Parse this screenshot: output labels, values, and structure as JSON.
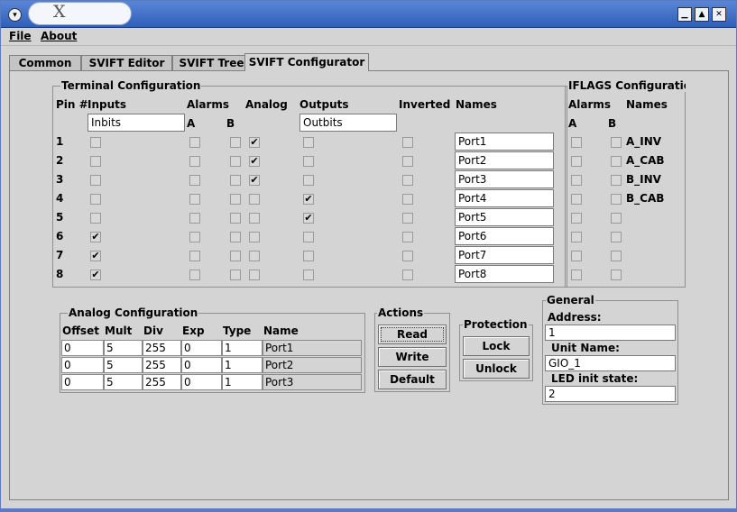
{
  "window": {
    "title_glyph": "X"
  },
  "menu": [
    "File",
    "About"
  ],
  "tabs": [
    "Common",
    "SVIFT Editor",
    "SVIFT Tree",
    "SVIFT Configurator"
  ],
  "terminal": {
    "title": "Terminal Configuration",
    "headers": {
      "pin": "Pin #",
      "inputs": "Inputs",
      "alarms": "Alarms",
      "analog": "Analog",
      "outputs": "Outputs",
      "inverted": "Inverted",
      "names": "Names",
      "a": "A",
      "b": "B"
    },
    "inputs_field": "Inbits",
    "outputs_field": "Outbits",
    "rows": [
      {
        "pin": "1",
        "name": "Port1",
        "input": false,
        "analog": true,
        "output": false
      },
      {
        "pin": "2",
        "name": "Port2",
        "input": false,
        "analog": true,
        "output": false
      },
      {
        "pin": "3",
        "name": "Port3",
        "input": false,
        "analog": true,
        "output": false
      },
      {
        "pin": "4",
        "name": "Port4",
        "input": false,
        "analog": false,
        "output": true
      },
      {
        "pin": "5",
        "name": "Port5",
        "input": false,
        "analog": false,
        "output": true
      },
      {
        "pin": "6",
        "name": "Port6",
        "input": true,
        "analog": false,
        "output": false
      },
      {
        "pin": "7",
        "name": "Port7",
        "input": true,
        "analog": false,
        "output": false
      },
      {
        "pin": "8",
        "name": "Port8",
        "input": true,
        "analog": false,
        "output": false
      }
    ]
  },
  "iflags": {
    "title": "IFLAGS Configuration",
    "headers": {
      "alarms": "Alarms",
      "names": "Names",
      "a": "A",
      "b": "B"
    },
    "names": [
      "A_INV",
      "A_CAB",
      "B_INV",
      "B_CAB",
      "",
      "",
      "",
      ""
    ]
  },
  "analog": {
    "title": "Analog Configuration",
    "headers": [
      "Offset",
      "Mult",
      "Div",
      "Exp",
      "Type",
      "Name"
    ],
    "rows": [
      [
        "0",
        "5",
        "255",
        "0",
        "1",
        "Port1"
      ],
      [
        "0",
        "5",
        "255",
        "0",
        "1",
        "Port2"
      ],
      [
        "0",
        "5",
        "255",
        "0",
        "1",
        "Port3"
      ]
    ]
  },
  "actions": {
    "title": "Actions",
    "read": "Read",
    "write": "Write",
    "default": "Default"
  },
  "protection": {
    "title": "Protection",
    "lock": "Lock",
    "unlock": "Unlock"
  },
  "general": {
    "title": "General",
    "address_label": "Address:",
    "address": "1",
    "unit_label": "Unit Name:",
    "unit": "GIO_1",
    "led_label": "LED init state:",
    "led": "2"
  }
}
